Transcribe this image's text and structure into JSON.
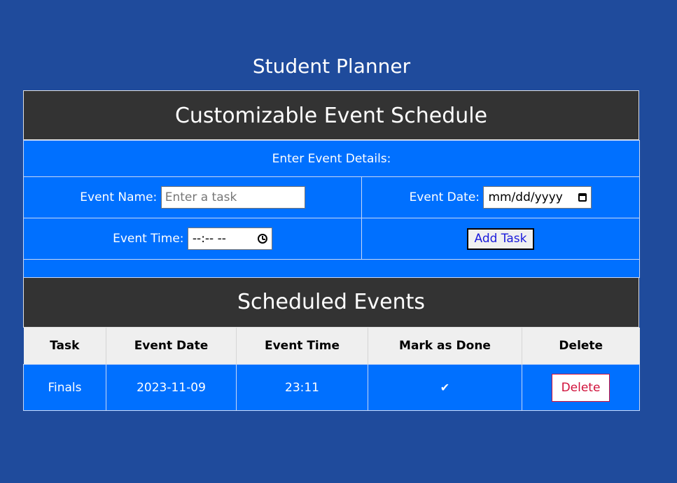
{
  "page": {
    "title": "Student Planner"
  },
  "schedule": {
    "title": "Customizable Event Schedule",
    "instructions": "Enter Event Details:",
    "name_label": "Event Name:",
    "name_placeholder": "Enter a task",
    "name_value": "",
    "date_label": "Event Date:",
    "date_value": "mm/dd/yyyy",
    "date_icon": "calendar-icon",
    "time_label": "Event Time:",
    "time_value": "--:-- --",
    "time_icon": "clock-icon",
    "add_label": "Add Task"
  },
  "events": {
    "title": "Scheduled Events",
    "columns": [
      "Task",
      "Event Date",
      "Event Time",
      "Mark as Done",
      "Delete"
    ],
    "rows": [
      {
        "task": "Finals",
        "date": "2023-11-09",
        "time": "23:11",
        "done": "✔",
        "delete_label": "Delete"
      }
    ]
  },
  "colors": {
    "background": "#1f4b9c",
    "header": "#333333",
    "cell": "#0070ff",
    "delete_accent": "#d0103a"
  }
}
